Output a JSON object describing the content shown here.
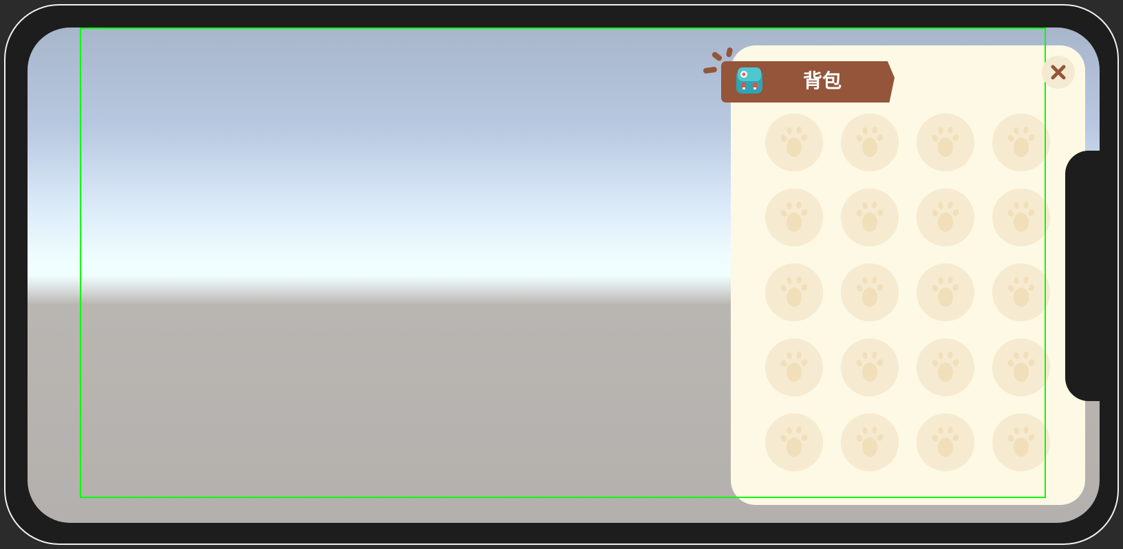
{
  "backpack": {
    "title": "背包",
    "icon": "backpack-icon",
    "close_icon": "close-icon",
    "slot_icon": "paw-icon",
    "rows": 5,
    "cols": 4
  },
  "colors": {
    "ribbon": "#94553a",
    "panel": "#fdf9e4",
    "slot": "#f6ead0",
    "safe_area_outline": "#00ff00"
  }
}
